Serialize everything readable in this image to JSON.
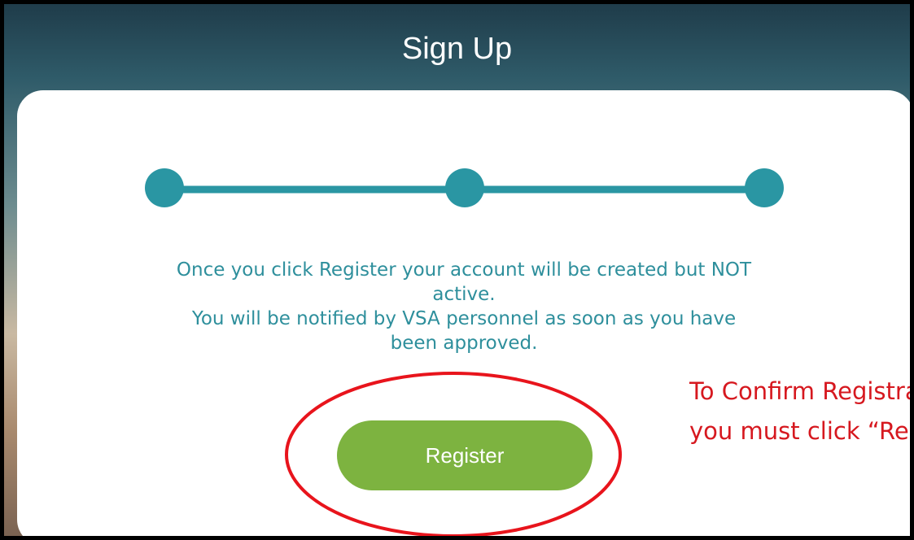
{
  "header": {
    "title": "Sign Up"
  },
  "stepper": {
    "total_steps": 3,
    "current_step": 3,
    "accent_color": "#2a96a3"
  },
  "message": {
    "line1": "Once you click Register your account will be created but NOT",
    "line2": "active.",
    "line3": "You will be notified by VSA personnel as soon as you have",
    "line4": "been approved."
  },
  "actions": {
    "register_label": "Register",
    "register_color": "#7db340"
  },
  "annotation": {
    "line1": "To Confirm Registration",
    "line2": "you must click “Register”",
    "color": "#d6181f"
  }
}
